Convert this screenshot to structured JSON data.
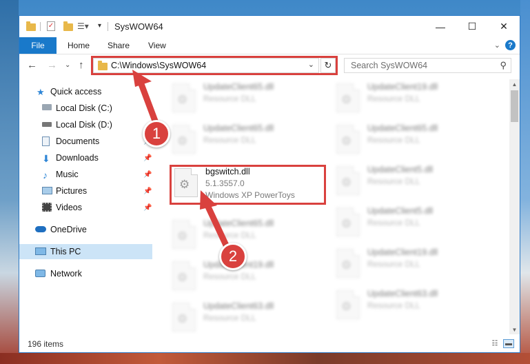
{
  "window": {
    "title": "SysWOW64"
  },
  "ribbon": {
    "file": "File",
    "tabs": [
      "Home",
      "Share",
      "View"
    ],
    "help": "?"
  },
  "address": {
    "path": "C:\\Windows\\SysWOW64",
    "search_placeholder": "Search SysWOW64"
  },
  "sidebar": {
    "items": [
      {
        "label": "Quick access",
        "icon": "star-icon"
      },
      {
        "label": "Local Disk (C:)",
        "icon": "drive-icon"
      },
      {
        "label": "Local Disk (D:)",
        "icon": "drive-icon"
      },
      {
        "label": "Documents",
        "icon": "documents-icon"
      },
      {
        "label": "Downloads",
        "icon": "download-icon"
      },
      {
        "label": "Music",
        "icon": "music-icon"
      },
      {
        "label": "Pictures",
        "icon": "pictures-icon"
      },
      {
        "label": "Videos",
        "icon": "videos-icon"
      },
      {
        "label": "OneDrive",
        "icon": "cloud-icon"
      },
      {
        "label": "This PC",
        "icon": "computer-icon"
      },
      {
        "label": "Network",
        "icon": "network-icon"
      }
    ]
  },
  "files": {
    "left": [
      {
        "name": "UpdateClient65.dll",
        "type": "Resource DLL"
      },
      {
        "name": "UpdateClient65.dll",
        "type": "Resource DLL"
      },
      {
        "name": "UpdateClient65.dll",
        "type": "Resource DLL"
      },
      {
        "name": "UpdateClient19.dll",
        "type": "Resource DLL"
      },
      {
        "name": "UpdateClient63.dll",
        "type": "Resource DLL"
      }
    ],
    "right": [
      {
        "name": "UpdateClient19.dll",
        "type": "Resource DLL"
      },
      {
        "name": "UpdateClient65.dll",
        "type": "Resource DLL"
      },
      {
        "name": "UpdateClient5.dll",
        "type": "Resource DLL"
      },
      {
        "name": "UpdateClient5.dll",
        "type": "Resource DLL"
      },
      {
        "name": "UpdateClient19.dll",
        "type": "Resource DLL"
      },
      {
        "name": "UpdateClient63.dll",
        "type": "Resource DLL"
      }
    ],
    "highlighted": {
      "name": "bgswitch.dll",
      "version": "5.1.3557.0",
      "description": "Windows XP PowerToys"
    }
  },
  "status": {
    "count": "196 items"
  },
  "annotations": {
    "step1": "1",
    "step2": "2",
    "color": "#d9413e"
  }
}
